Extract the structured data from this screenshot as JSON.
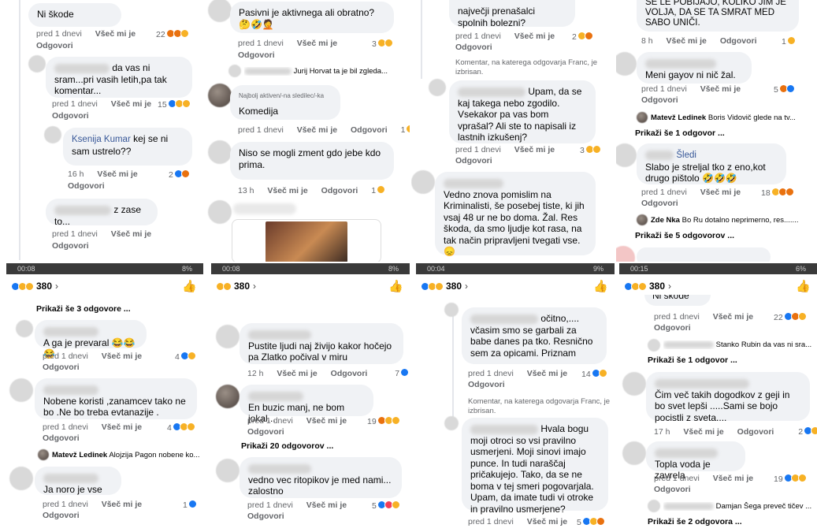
{
  "ui": {
    "just_before": "pred 1 dnevi",
    "like": "Všeč mi je",
    "reply": "Odgovori"
  },
  "p1": {
    "c1": {
      "text": "Ni škode",
      "count": "22"
    },
    "c2": {
      "text": "da vas ni sram...pri vasih letih,pa tak komentar...",
      "count": "15"
    },
    "c3": {
      "name": "Ksenija Kumar",
      "text": "kej se ni sam ustrelo??",
      "time": "16 h",
      "count": "2"
    },
    "c4": {
      "text": "z zase to..."
    }
  },
  "p2": {
    "c1": {
      "text": "Pasivni je aktivnega ali obratno? 🤔🤣🤦",
      "count": "3"
    },
    "preview1": "Jurij Horvat ta je bil zgleda...",
    "c2": {
      "badge": "Najbolj aktiven/-na sledilec/-ka",
      "text": "Komedija",
      "count": "1"
    },
    "c3": {
      "text": "Niso se mogli zment gdo jebe kdo prima.",
      "time": "13 h",
      "count": "1"
    }
  },
  "p3": {
    "c1": {
      "text": "največji prenašalci spolnih bolezni?",
      "count": "2"
    },
    "note1": "Komentar, na katerega odgovarja Franc, je izbrisan.",
    "c2": {
      "text": "Upam, da se kaj takega nebo zgodilo. Vsekakor pa vas bom vprašal? Ali ste to napisali iz lastnih izkušenj?",
      "count": "3"
    },
    "c3": {
      "text": "Vedno znova pomislim na Kriminalisti, še posebej tiste, ki jih vsaj 48 ur ne bo doma. Žal. Res škoda, da smo ljudje kot rasa, na tak način pripravljeni tvegati vse. 😞"
    }
  },
  "p4": {
    "c1": {
      "text": "SE LE POBIJAJO, KOLIKO JIM JE VOLJA, DA SE TA SMRAT MED SABO UNIČI.",
      "time": "8 h",
      "count": "1"
    },
    "c2": {
      "text": "Meni gayov ni nič žal.",
      "count": "5"
    },
    "preview1_name": "Matevž Ledinek",
    "preview1_text": "Boris Vidovič glede na tv...",
    "more1": "Prikaži še 1 odgovor ...",
    "c3": {
      "name": "Šledi",
      "text": "Slabo je streljal tko z eno,kot drugo pištolo 🤣🤣🤣",
      "count": "18"
    },
    "preview2_name": "Zde Nka",
    "preview2_text": "Bo Ru dotalno neprimerno, res.......",
    "more2": "Prikaži še 5 odgovorov ..."
  },
  "p5": {
    "status": "00:08",
    "battery": "8%",
    "react_count": "380",
    "more1": "Prikaži še 3 odgovore ...",
    "c1": {
      "text": "A ga je prevaral 😂😂😂",
      "count": "4"
    },
    "c2": {
      "text": "Nobene koristi ,zanamcev tako ne bo .Ne bo treba evtanazije .",
      "count": "4"
    },
    "preview_name": "Matevž Ledinek",
    "preview_text": "Alojzija Pagon nobene ko...",
    "c3": {
      "text": "Ja noro je vse",
      "count": "1"
    }
  },
  "p6": {
    "status": "00:08",
    "battery": "8%",
    "react_count": "380",
    "c1": {
      "text": "Pustite ljudi naj živijo kakor hočejo pa Zlatko počival v miru",
      "time": "12 h",
      "count": "7"
    },
    "c2": {
      "text": "En buzic manj, ne bom jokal...",
      "count": "19"
    },
    "more1": "Prikaži 20 odgovorov ...",
    "c3": {
      "text": "vedno vec ritopikov je med nami... zalostno",
      "count": "5"
    }
  },
  "p7": {
    "status": "00:04",
    "battery": "9%",
    "react_count": "380",
    "c1": {
      "text": "očitno,.... včasim smo se garbali za babe danes pa tko. Resnično sem za opicami. Priznam",
      "count": "14"
    },
    "note1": "Komentar, na katerega odgovarja Franc, je izbrisan.",
    "c2": {
      "text": "Hvala bogu moji otroci so vsi pravilno usmerjeni. Moji sinovi imajo punce. In tudi naraščaj pričakujejo. Tako, da se ne boma v tej smeri pogovarjala. Upam, da imate tudi vi otroke in pravilno usmerjene?",
      "count": "5"
    }
  },
  "p8": {
    "status": "00:15",
    "battery": "6%",
    "react_count": "380",
    "c0": {
      "text": "Ni škode",
      "count": "22"
    },
    "preview1": "Stanko Rubin da vas ni sra...",
    "more1": "Prikaži še 1 odgovor ...",
    "c1": {
      "text": "Čim več takih dogodkov z geji in bo svet lepši .....Sami se bojo pocistli z sveta....",
      "time": "17 h",
      "count": "2"
    },
    "c2": {
      "text": "Topla voda je zavrela",
      "count": "19"
    },
    "preview2": "Damjan Šega preveč tičev ...",
    "more2": "Prikaži še 2 odgovora ..."
  }
}
